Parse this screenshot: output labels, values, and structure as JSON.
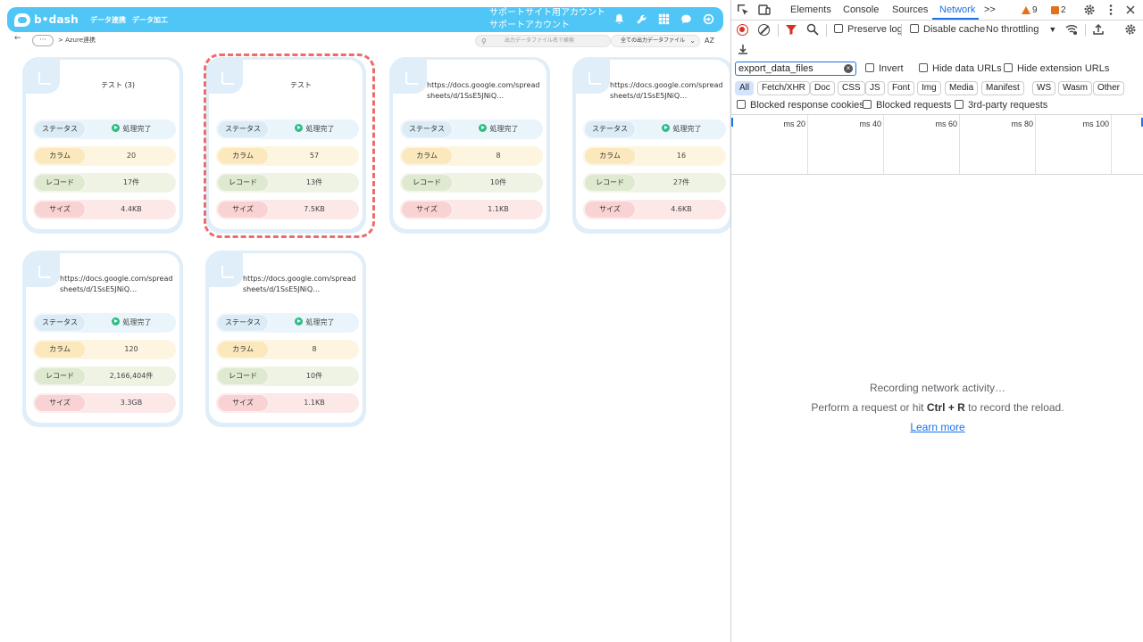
{
  "app": {
    "logo_text": "b•dash",
    "nav": [
      "データ連携",
      "データ加工"
    ],
    "support_lines": [
      "サポートサイト用アカウント",
      "サポートアカウント"
    ],
    "breadcrumb_dots": "···",
    "breadcrumb": "> Azure連携",
    "search_placeholder": "出力データファイル名で検索",
    "filter_label": "全ての出力データファイル",
    "sort_label": "AZ",
    "row_labels": {
      "status": "ステータス",
      "column": "カラム",
      "record": "レコード",
      "size": "サイズ"
    },
    "cards": [
      {
        "title": "テスト (3)",
        "status": "処理完了",
        "column": "20",
        "record": "17件",
        "size": "4.4KB"
      },
      {
        "title": "テスト",
        "status": "処理完了",
        "column": "57",
        "record": "13件",
        "size": "7.5KB"
      },
      {
        "title": "https://docs.google.com/spreadsheets/d/1SsE5JNiQ…",
        "status": "処理完了",
        "column": "8",
        "record": "10件",
        "size": "1.1KB"
      },
      {
        "title": "https://docs.google.com/spreadsheets/d/1SsE5JNiQ…",
        "status": "処理完了",
        "column": "16",
        "record": "27件",
        "size": "4.6KB"
      },
      {
        "title": "https://docs.google.com/spreadsheets/d/1SsE5JNiQ…",
        "status": "処理完了",
        "column": "120",
        "record": "2,166,404件",
        "size": "3.3GB"
      },
      {
        "title": "https://docs.google.com/spreadsheets/d/1SsE5JNiQ…",
        "status": "処理完了",
        "column": "8",
        "record": "10件",
        "size": "1.1KB"
      }
    ],
    "colors": {
      "header": "#4fc6f5",
      "highlight": "#ee6b6b",
      "status_ok": "#2ebc85"
    }
  },
  "devtools": {
    "tabs": [
      "Elements",
      "Console",
      "Sources",
      "Network"
    ],
    "active_tab": "Network",
    "more_tabs": ">>",
    "warnings": "9",
    "issues": "2",
    "toolbar": {
      "preserve_log": "Preserve log",
      "disable_cache": "Disable cache",
      "throttling": "No throttling"
    },
    "filter": {
      "value": "export_data_files",
      "invert": "Invert",
      "hide_data_urls": "Hide data URLs",
      "hide_ext_urls": "Hide extension URLs"
    },
    "types": [
      "All",
      "Fetch/XHR",
      "Doc",
      "CSS",
      "JS",
      "Font",
      "Img",
      "Media",
      "Manifest",
      "WS",
      "Wasm",
      "Other"
    ],
    "options": {
      "blocked_cookies": "Blocked response cookies",
      "blocked_requests": "Blocked requests",
      "third_party": "3rd-party requests"
    },
    "timeline_labels": [
      "20 ms",
      "40 ms",
      "60 ms",
      "80 ms",
      "100 ms"
    ],
    "empty": {
      "line1": "Recording network activity…",
      "line2_pre": "Perform a request or hit ",
      "line2_key": "Ctrl + R",
      "line2_post": " to record the reload.",
      "learn_more": "Learn more"
    }
  }
}
